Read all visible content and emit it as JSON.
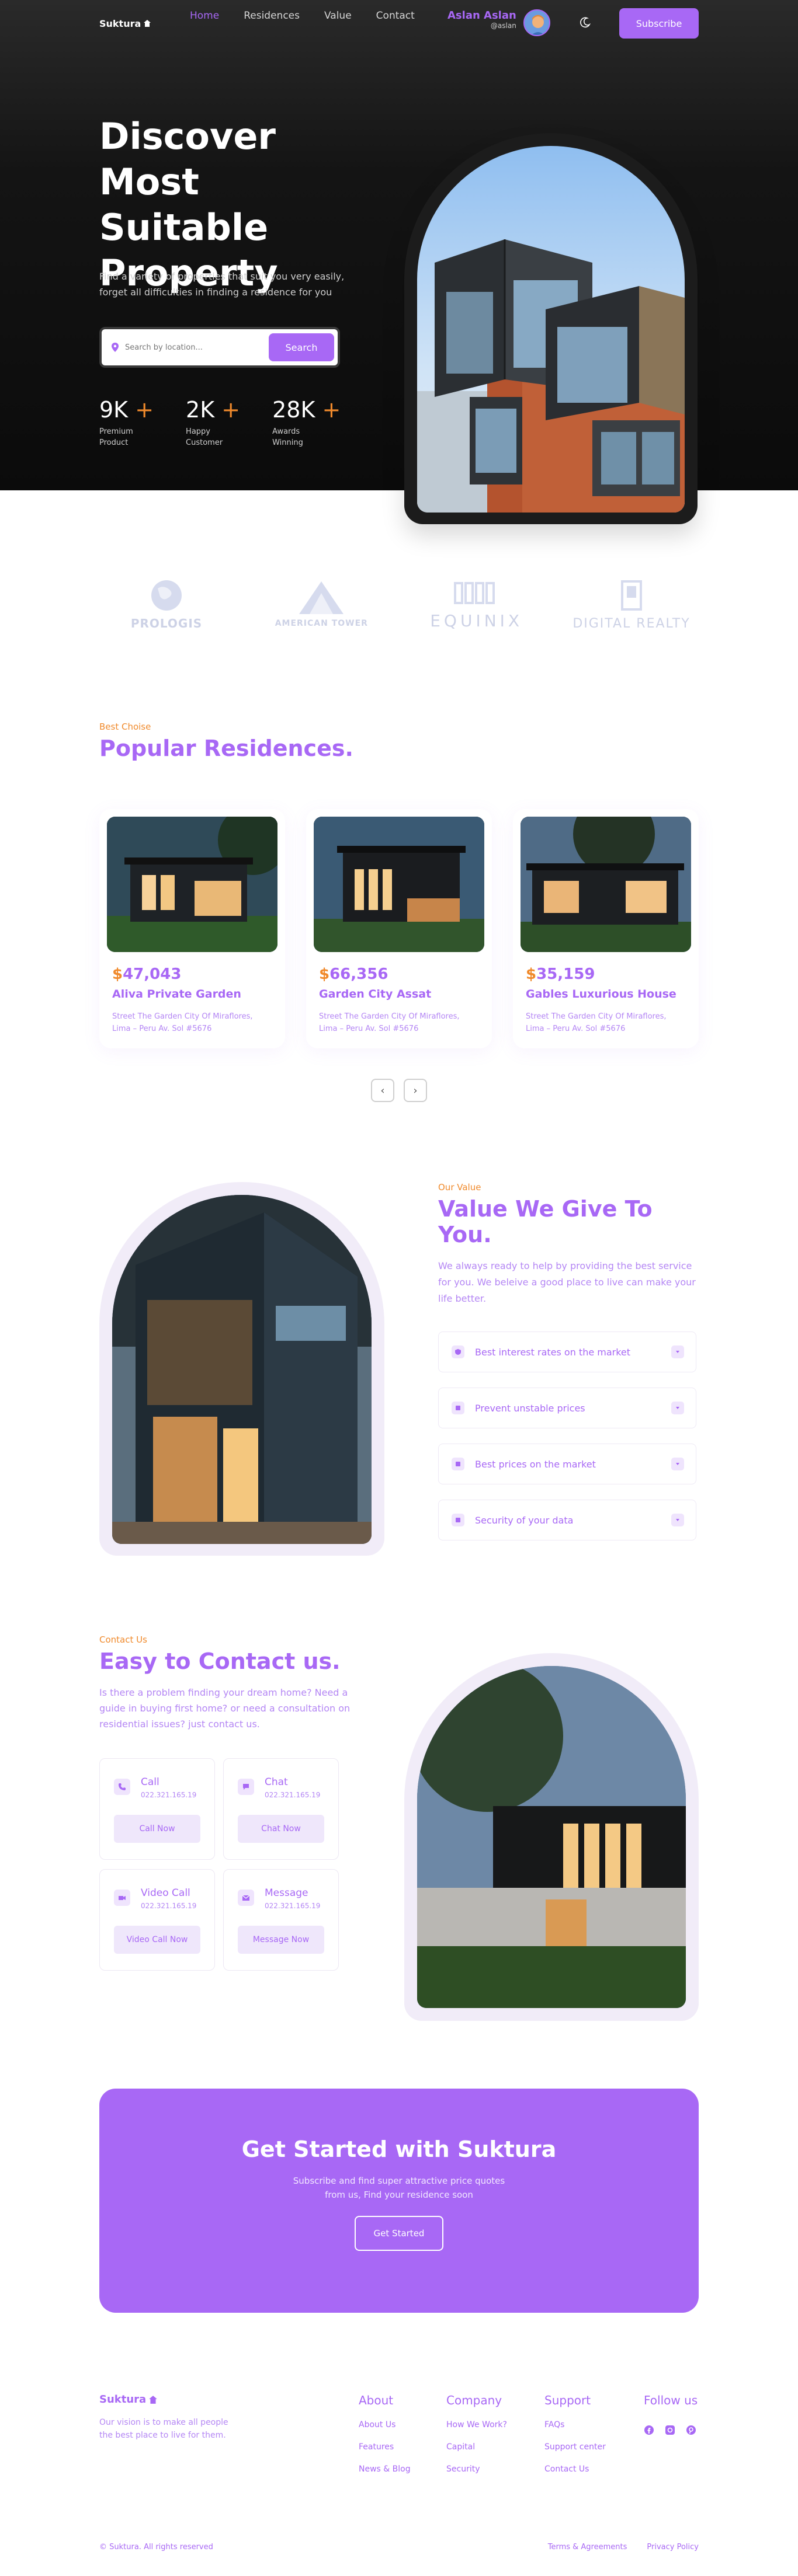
{
  "colors": {
    "accent": "#a868f5",
    "orange": "#f08a2c",
    "dark": "#111111"
  },
  "nav": {
    "logo": "Suktura",
    "links": [
      "Home",
      "Residences",
      "Value",
      "Contact"
    ],
    "user_name": "Aslan Aslan",
    "user_handle": "@aslan",
    "subscribe": "Subscribe"
  },
  "hero": {
    "title": "Discover Most Suitable Property",
    "description": "Find a variety of properties that suit you very easily, forget all difficulties in finding a residence for you",
    "search_placeholder": "Search by location...",
    "search_button": "Search",
    "stats": [
      {
        "value": "9K",
        "plus": "+",
        "label": "Premium Product"
      },
      {
        "value": "2K",
        "plus": "+",
        "label": "Happy Customer"
      },
      {
        "value": "28K",
        "plus": "+",
        "label": "Awards Winning"
      }
    ]
  },
  "brands": [
    "PROLOGIS",
    "AMERICAN TOWER",
    "EQUINIX",
    "DIGITAL REALTY"
  ],
  "popular": {
    "eyebrow": "Best Choise",
    "title": "Popular Residences.",
    "cards": [
      {
        "price": "47,043",
        "currency": "$",
        "name": "Aliva Private Garden",
        "address": "Street The Garden City Of Miraflores, Lima – Peru Av. Sol #5676"
      },
      {
        "price": "66,356",
        "currency": "$",
        "name": "Garden City Assat",
        "address": "Street The Garden City Of Miraflores, Lima – Peru Av. Sol #5676"
      },
      {
        "price": "35,159",
        "currency": "$",
        "name": "Gables Luxurious House",
        "address": "Street The Garden City Of Miraflores, Lima – Peru Av. Sol #5676"
      }
    ],
    "prev": "‹",
    "next": "›"
  },
  "value": {
    "eyebrow": "Our Value",
    "title": "Value We Give To You.",
    "description": "We always ready to help by providing the best service for you. We beleive a good place to live can make your life better.",
    "items": [
      "Best interest rates on the market",
      "Prevent unstable prices",
      "Best prices on the market",
      "Security of your data"
    ]
  },
  "contact": {
    "eyebrow": "Contact Us",
    "title": "Easy to Contact us.",
    "description": "Is there a problem finding your dream home? Need a guide in buying first home? or need a consultation on residential issues? just contact us.",
    "cards": [
      {
        "title": "Call",
        "phone": "022.321.165.19",
        "button": "Call Now"
      },
      {
        "title": "Chat",
        "phone": "022.321.165.19",
        "button": "Chat Now"
      },
      {
        "title": "Video Call",
        "phone": "022.321.165.19",
        "button": "Video Call Now"
      },
      {
        "title": "Message",
        "phone": "022.321.165.19",
        "button": "Message Now"
      }
    ]
  },
  "cta": {
    "title": "Get Started with Suktura",
    "description": "Subscribe and find super attractive price quotes from us, Find your residence soon",
    "button": "Get Started"
  },
  "footer": {
    "logo": "Suktura",
    "vision": "Our vision is to make all people the best place to live for them.",
    "columns": [
      {
        "title": "About",
        "links": [
          "About Us",
          "Features",
          "News & Blog"
        ]
      },
      {
        "title": "Company",
        "links": [
          "How We Work?",
          "Capital",
          "Security"
        ]
      },
      {
        "title": "Support",
        "links": [
          "FAQs",
          "Support center",
          "Contact Us"
        ]
      }
    ],
    "follow_title": "Follow us",
    "copyright": "© Suktura. All rights reserved",
    "terms": "Terms & Agreements",
    "privacy": "Privacy Policy"
  }
}
